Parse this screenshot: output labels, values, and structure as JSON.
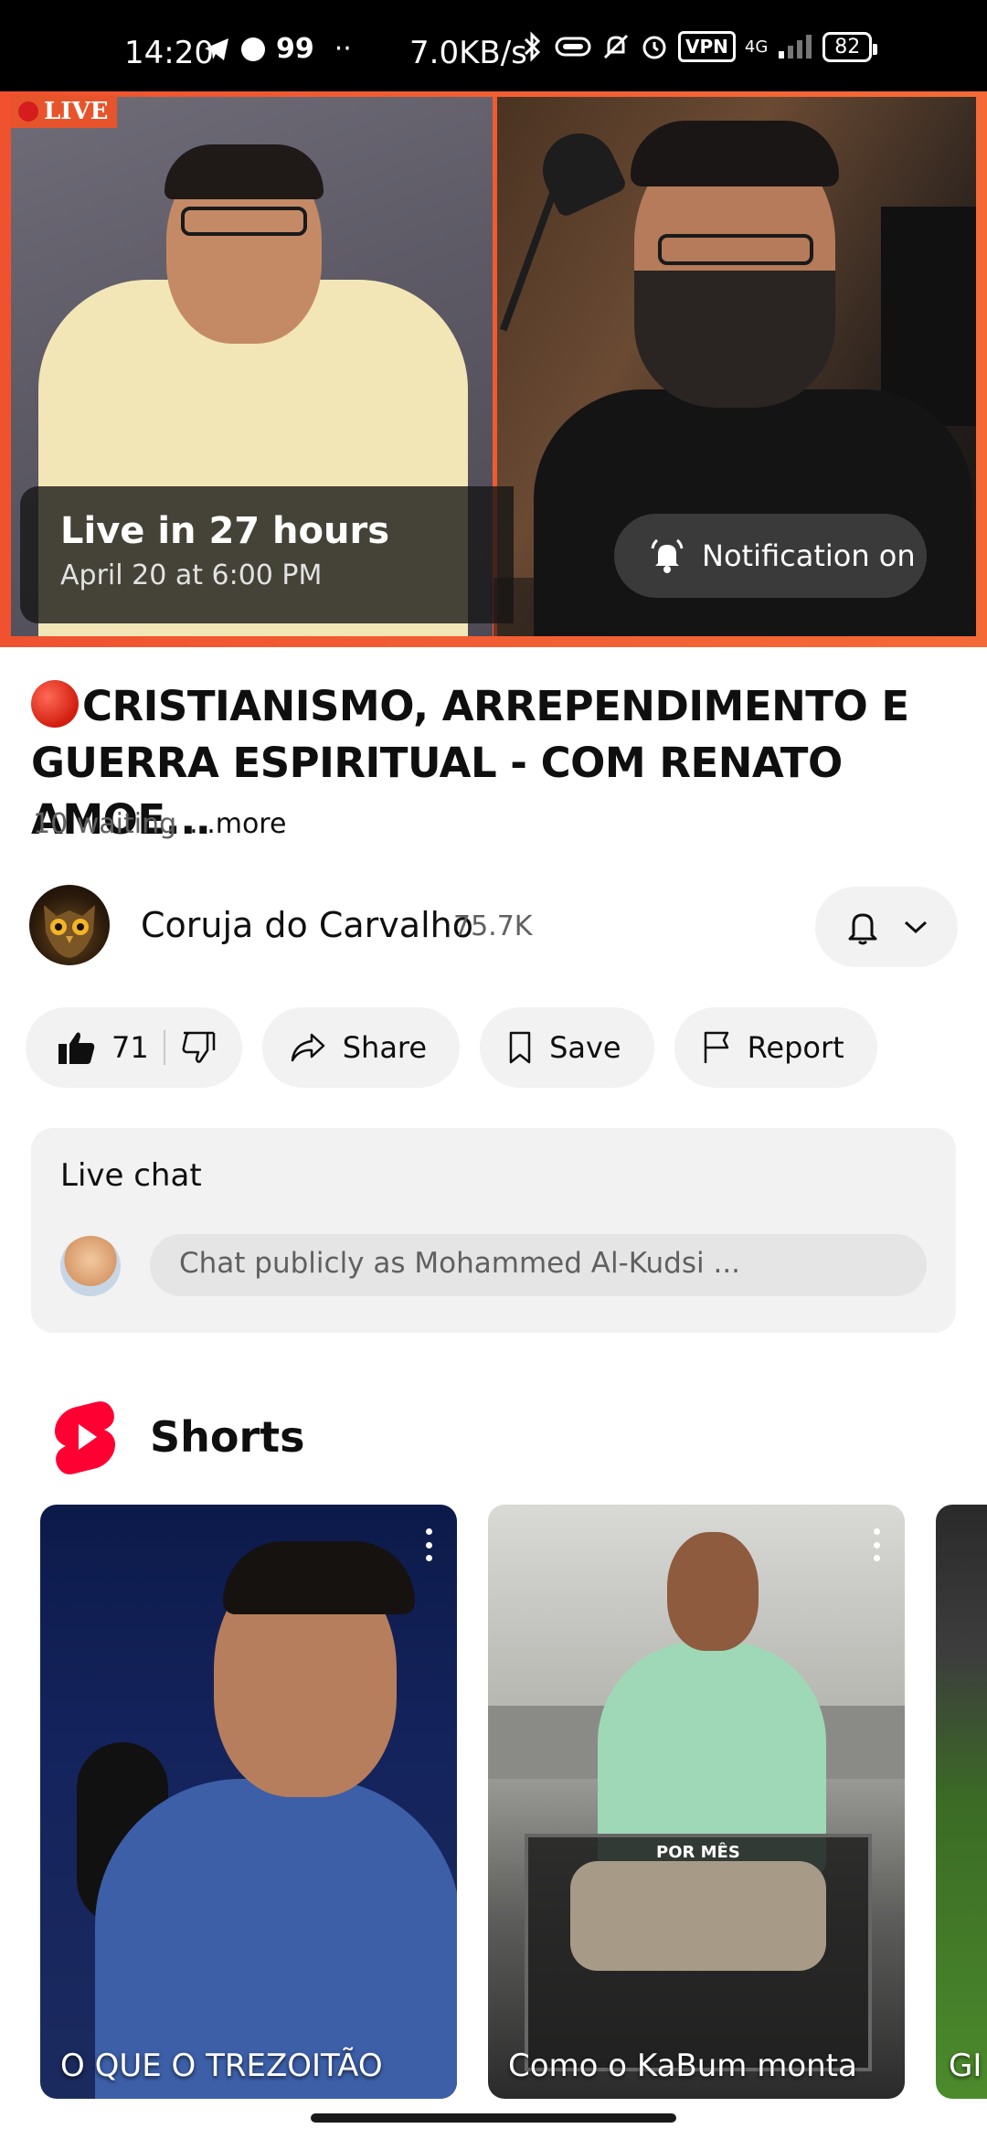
{
  "status_bar": {
    "time": "14:20",
    "notif_count": "99",
    "more_dots": "··",
    "net_rate": "7.0KB/s",
    "vpn": "VPN",
    "network": "4G",
    "battery": "82"
  },
  "player": {
    "live_badge": "LIVE",
    "live_in": "Live in 27 hours",
    "scheduled": "April 20 at 6:00 PM",
    "notification_label": "Notification on"
  },
  "video": {
    "title": "CRISTIANISMO, ARREPENDIMENTO E GUERRA ESPIRITUAL - COM RENATO AMOE...",
    "waiting": "10 waiting",
    "more": "...more"
  },
  "channel": {
    "name": "Coruja do Carvalho",
    "subscribers": "75.7K"
  },
  "actions": {
    "like_count": "71",
    "share": "Share",
    "save": "Save",
    "report": "Report"
  },
  "live_chat": {
    "title": "Live chat",
    "placeholder": "Chat publicly as Mohammed Al-Kudsi ..."
  },
  "shorts": {
    "title": "Shorts",
    "items": [
      {
        "caption": "O QUE O TREZOITÃO"
      },
      {
        "caption": "Como o KaBum monta",
        "overlay": "POR MÊS"
      },
      {
        "caption": "GI"
      }
    ]
  },
  "colors": {
    "live_red": "#e7542c",
    "shorts_red": "#ff0033",
    "pill_bg": "#f2f2f2"
  }
}
